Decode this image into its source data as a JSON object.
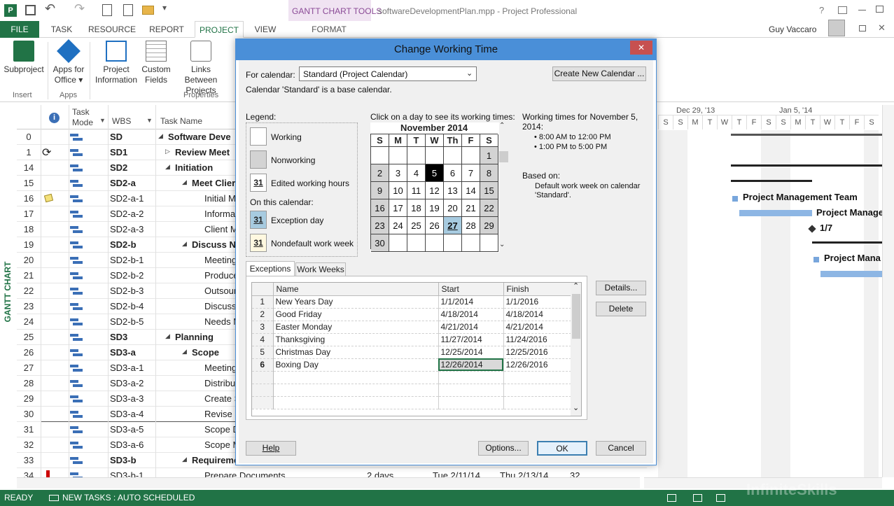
{
  "app": {
    "title": "softwareDevelopmentPlan.mpp - Project Professional",
    "context_tab": "GANTT CHART TOOLS",
    "user": "Guy Vaccaro",
    "help_glyph": "?",
    "accent": "#217346"
  },
  "tabs": [
    "FILE",
    "TASK",
    "RESOURCE",
    "REPORT",
    "PROJECT",
    "VIEW",
    "FORMAT"
  ],
  "active_tab": "PROJECT",
  "ribbon": {
    "buttons": [
      {
        "label1": "Subproject",
        "label2": "",
        "icon": "subproject-icon"
      },
      {
        "label1": "Apps for",
        "label2": "Office ▾",
        "icon": "apps-for-office-icon"
      },
      {
        "label1": "Project",
        "label2": "Information",
        "icon": "project-information-icon"
      },
      {
        "label1": "Custom",
        "label2": "Fields",
        "icon": "custom-fields-icon"
      },
      {
        "label1": "Links Between",
        "label2": "Projects",
        "icon": "links-between-projects-icon"
      }
    ],
    "groups": [
      "Insert",
      "Apps",
      "Properties"
    ]
  },
  "sidebar_label": "GANTT CHART",
  "grid": {
    "headers": {
      "task_mode_1": "Task",
      "task_mode_2": "Mode",
      "wbs": "WBS",
      "task_name": "Task Name"
    },
    "rows": [
      {
        "id": "0",
        "wbs": "SD",
        "name": "Software Deve",
        "bold": true,
        "indent": 0,
        "ind": ""
      },
      {
        "id": "1",
        "wbs": "SD1",
        "name": "Review Meet",
        "bold": true,
        "indent": 1,
        "ind": "recurring"
      },
      {
        "id": "14",
        "wbs": "SD2",
        "name": "Initiation",
        "bold": true,
        "indent": 1,
        "ind": ""
      },
      {
        "id": "15",
        "wbs": "SD2-a",
        "name": "Meet Clier",
        "bold": true,
        "indent": 2,
        "ind": ""
      },
      {
        "id": "16",
        "wbs": "SD2-a-1",
        "name": "Initial M",
        "bold": false,
        "indent": 3,
        "ind": "note"
      },
      {
        "id": "17",
        "wbs": "SD2-a-2",
        "name": "Informa",
        "bold": false,
        "indent": 3,
        "ind": ""
      },
      {
        "id": "18",
        "wbs": "SD2-a-3",
        "name": "Client M",
        "bold": false,
        "indent": 3,
        "ind": ""
      },
      {
        "id": "19",
        "wbs": "SD2-b",
        "name": "Discuss Ne",
        "bold": true,
        "indent": 2,
        "ind": ""
      },
      {
        "id": "20",
        "wbs": "SD2-b-1",
        "name": "Meeting",
        "bold": false,
        "indent": 3,
        "ind": ""
      },
      {
        "id": "21",
        "wbs": "SD2-b-2",
        "name": "Produce",
        "bold": false,
        "indent": 3,
        "ind": ""
      },
      {
        "id": "22",
        "wbs": "SD2-b-3",
        "name": "Outsour",
        "bold": false,
        "indent": 3,
        "ind": ""
      },
      {
        "id": "23",
        "wbs": "SD2-b-4",
        "name": "Discuss",
        "bold": false,
        "indent": 3,
        "ind": ""
      },
      {
        "id": "24",
        "wbs": "SD2-b-5",
        "name": "Needs M",
        "bold": false,
        "indent": 3,
        "ind": ""
      },
      {
        "id": "25",
        "wbs": "SD3",
        "name": "Planning",
        "bold": true,
        "indent": 1,
        "ind": ""
      },
      {
        "id": "26",
        "wbs": "SD3-a",
        "name": "Scope",
        "bold": true,
        "indent": 2,
        "ind": ""
      },
      {
        "id": "27",
        "wbs": "SD3-a-1",
        "name": "Meeting",
        "bold": false,
        "indent": 3,
        "ind": ""
      },
      {
        "id": "28",
        "wbs": "SD3-a-2",
        "name": "Distribu",
        "bold": false,
        "indent": 3,
        "ind": ""
      },
      {
        "id": "29",
        "wbs": "SD3-a-3",
        "name": "Create S",
        "bold": false,
        "indent": 3,
        "ind": ""
      },
      {
        "id": "30",
        "wbs": "SD3-a-4",
        "name": "Revise a",
        "bold": false,
        "indent": 3,
        "ind": ""
      },
      {
        "id": "31",
        "wbs": "SD3-a-5",
        "name": "Scope D",
        "bold": false,
        "indent": 3,
        "ind": ""
      },
      {
        "id": "32",
        "wbs": "SD3-a-6",
        "name": "Scope M",
        "bold": false,
        "indent": 3,
        "ind": ""
      },
      {
        "id": "33",
        "wbs": "SD3-b",
        "name": "Requireme",
        "bold": true,
        "indent": 2,
        "ind": ""
      },
      {
        "id": "34",
        "wbs": "SD3-b-1",
        "name": "Prepare Documents",
        "bold": false,
        "indent": 3,
        "ind": "flag"
      }
    ],
    "last_row_extra": {
      "duration": "2 days",
      "start": "Tue 2/11/14",
      "finish": "Thu 2/13/14",
      "pred": "32"
    }
  },
  "timeline": {
    "week1": "Dec 29, '13",
    "week2": "Jan 5, '14",
    "days": [
      "S",
      "S",
      "M",
      "T",
      "W",
      "T",
      "F",
      "S",
      "S",
      "M",
      "T",
      "W",
      "T",
      "F",
      "S"
    ],
    "labels": [
      {
        "text": "Project Management Team"
      },
      {
        "text": "Project Manage"
      },
      {
        "text": "1/7"
      },
      {
        "text": "Project Mana"
      }
    ]
  },
  "status": {
    "ready": "READY",
    "mode": "NEW TASKS : AUTO SCHEDULED",
    "watermark": "InfiniteSkills"
  },
  "dialog": {
    "title": "Change Working Time",
    "close_glyph": "✕",
    "for_calendar_label": "For calendar:",
    "calendar_value": "Standard (Project Calendar)",
    "create_new": "Create New Calendar ...",
    "base_note": "Calendar 'Standard' is a base calendar.",
    "legend_title": "Legend:",
    "legend": {
      "working": "Working",
      "nonworking": "Nonworking",
      "edited": "Edited working hours",
      "on_this": "On this calendar:",
      "exception": "Exception day",
      "nondefault": "Nondefault work week",
      "day31": "31"
    },
    "click_hint": "Click on a day to see its working times:",
    "month": "November 2014",
    "weekdays": [
      "S",
      "M",
      "T",
      "W",
      "Th",
      "F",
      "S"
    ],
    "calendar_cells": [
      "",
      "",
      "",
      "",
      "",
      "",
      "1",
      "2",
      "3",
      "4",
      "5",
      "6",
      "7",
      "8",
      "9",
      "10",
      "11",
      "12",
      "13",
      "14",
      "15",
      "16",
      "17",
      "18",
      "19",
      "20",
      "21",
      "22",
      "23",
      "24",
      "25",
      "26",
      "27",
      "28",
      "29",
      "30",
      "",
      "",
      "",
      "",
      "",
      ""
    ],
    "selected_day": "5",
    "exception_day": "27",
    "working_times_title": "Working times for November 5, 2014:",
    "times": [
      "• 8:00 AM to 12:00 PM",
      "• 1:00 PM to 5:00 PM"
    ],
    "based_on_title": "Based on:",
    "based_on_text": "Default work week on calendar 'Standard'.",
    "tabs": [
      "Exceptions",
      "Work Weeks"
    ],
    "ex_headers": {
      "name": "Name",
      "start": "Start",
      "finish": "Finish"
    },
    "exceptions": [
      {
        "n": "1",
        "name": "New Years Day",
        "start": "1/1/2014",
        "finish": "1/1/2016"
      },
      {
        "n": "2",
        "name": "Good Friday",
        "start": "4/18/2014",
        "finish": "4/18/2014"
      },
      {
        "n": "3",
        "name": "Easter Monday",
        "start": "4/21/2014",
        "finish": "4/21/2014"
      },
      {
        "n": "4",
        "name": "Thanksgiving",
        "start": "11/27/2014",
        "finish": "11/24/2016"
      },
      {
        "n": "5",
        "name": "Christmas Day",
        "start": "12/25/2014",
        "finish": "12/25/2016"
      },
      {
        "n": "6",
        "name": "Boxing Day",
        "start": "12/26/2014",
        "finish": "12/26/2016"
      }
    ],
    "details": "Details...",
    "delete": "Delete",
    "help": "Help",
    "options": "Options...",
    "ok": "OK",
    "cancel": "Cancel"
  }
}
